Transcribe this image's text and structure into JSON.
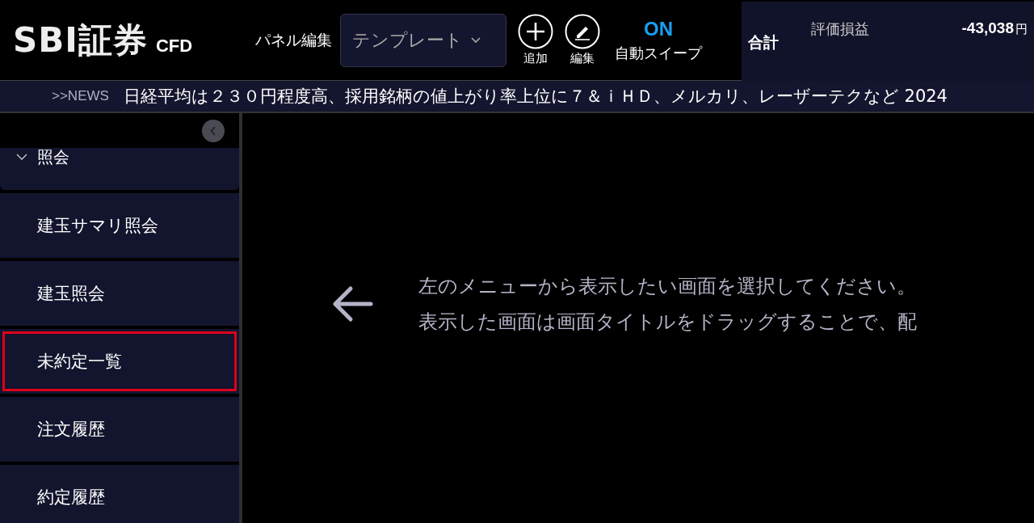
{
  "header": {
    "logo": "SBI証券",
    "logo_sub": "CFD",
    "panel_edit": "パネル編集",
    "template": "テンプレート",
    "actions": [
      {
        "kind": "add",
        "label": "追加"
      },
      {
        "kind": "edit",
        "label": "編集"
      }
    ],
    "sweep": {
      "state": "ON",
      "label": "自動スイープ"
    }
  },
  "summary": {
    "title": "合計",
    "label": "評価損益",
    "value": "-43,038",
    "unit": "円"
  },
  "news": {
    "tag": ">>NEWS",
    "headline": "日経平均は２３０円程度高、採用銘柄の値上がり率上位に７＆ｉＨＤ、メルカリ、レーザーテクなど  2024"
  },
  "sidebar": {
    "group": {
      "label": "照会",
      "expanded": true
    },
    "items": [
      {
        "label": "建玉サマリ照会",
        "highlighted": false
      },
      {
        "label": "建玉照会",
        "highlighted": false
      },
      {
        "label": "未約定一覧",
        "highlighted": true
      },
      {
        "label": "注文履歴",
        "highlighted": false
      },
      {
        "label": "約定履歴",
        "highlighted": false
      }
    ]
  },
  "main": {
    "lines": [
      "左のメニューから表示したい画面を選択してください。",
      "表示した画面は画面タイトルをドラッグすることで、配"
    ]
  }
}
